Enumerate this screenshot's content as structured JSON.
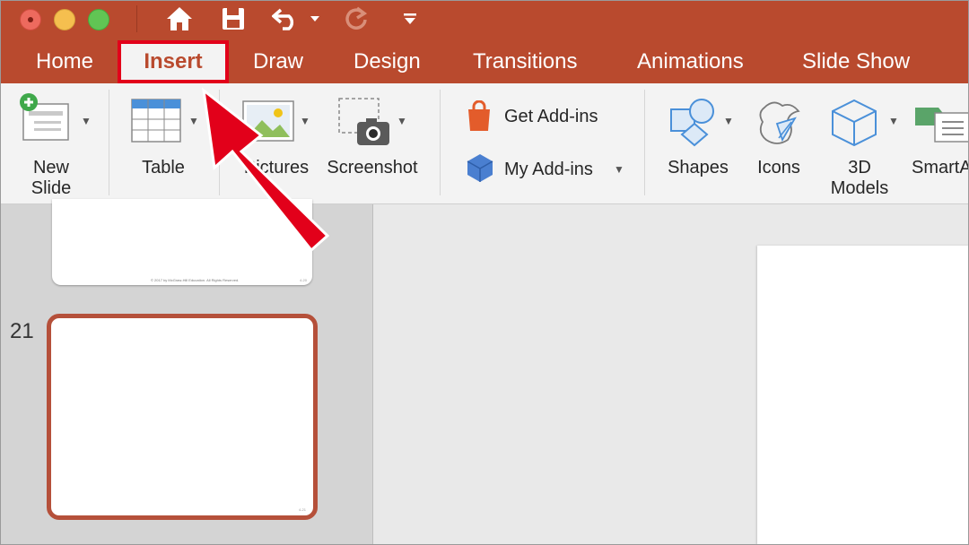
{
  "title_bar": {
    "window_controls": [
      "close",
      "minimize",
      "maximize"
    ],
    "quick_access": [
      "home-icon",
      "save-icon",
      "undo-icon",
      "undo-dropdown-icon",
      "redo-icon",
      "customize-toolbar-icon"
    ]
  },
  "tabs": [
    {
      "label": "Home"
    },
    {
      "label": "Insert",
      "selected": true
    },
    {
      "label": "Draw"
    },
    {
      "label": "Design"
    },
    {
      "label": "Transitions"
    },
    {
      "label": "Animations"
    },
    {
      "label": "Slide Show"
    }
  ],
  "ribbon": {
    "new_slide": {
      "line1": "New",
      "line2": "Slide"
    },
    "table": "Table",
    "pictures": "Pictures",
    "screenshot": "Screenshot",
    "get_addins": "Get Add-ins",
    "my_addins": "My Add-ins",
    "shapes": "Shapes",
    "icons": "Icons",
    "models_3d": {
      "line1": "3D",
      "line2": "Models"
    },
    "smartart": "SmartArt"
  },
  "slides_panel": {
    "previous_slide_footer": "© 2017 by McGraw-Hill Education. All Rights Reserved.",
    "previous_slide_page": "4-20",
    "current_slide_number": "21",
    "current_slide_page": "4-21"
  },
  "colors": {
    "accent": "#b94a2e",
    "highlight": "#e2001a",
    "arrow": "#e2001a"
  }
}
